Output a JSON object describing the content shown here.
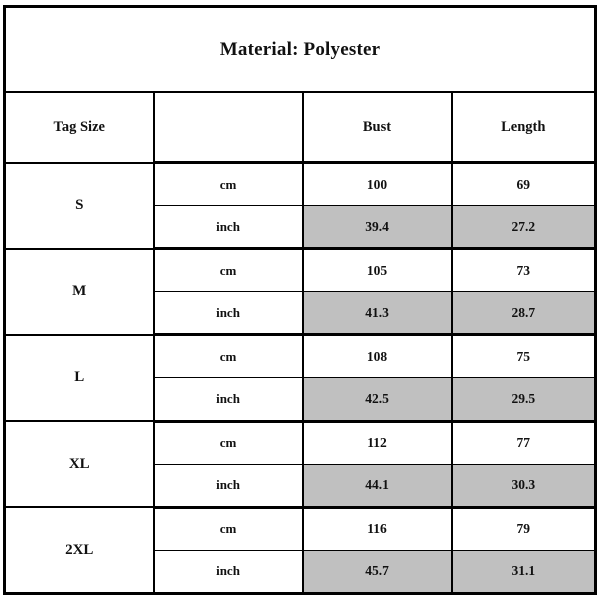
{
  "title": "Material: Polyester",
  "headers": {
    "size": "Tag Size",
    "unit": "",
    "bust": "Bust",
    "length": "Length"
  },
  "units": {
    "metric": "cm",
    "imperial": "inch"
  },
  "colors": {
    "shaded_row_background": "#c0c0c0",
    "border": "#000000",
    "page_background": "#ffffff"
  },
  "rows": [
    {
      "size": "S",
      "cm": {
        "unit": "cm",
        "bust": "100",
        "length": "69"
      },
      "inch": {
        "unit": "inch",
        "bust": "39.4",
        "length": "27.2"
      }
    },
    {
      "size": "M",
      "cm": {
        "unit": "cm",
        "bust": "105",
        "length": "73"
      },
      "inch": {
        "unit": "inch",
        "bust": "41.3",
        "length": "28.7"
      }
    },
    {
      "size": "L",
      "cm": {
        "unit": "cm",
        "bust": "108",
        "length": "75"
      },
      "inch": {
        "unit": "inch",
        "bust": "42.5",
        "length": "29.5"
      }
    },
    {
      "size": "XL",
      "cm": {
        "unit": "cm",
        "bust": "112",
        "length": "77"
      },
      "inch": {
        "unit": "inch",
        "bust": "44.1",
        "length": "30.3"
      }
    },
    {
      "size": "2XL",
      "cm": {
        "unit": "cm",
        "bust": "116",
        "length": "79"
      },
      "inch": {
        "unit": "inch",
        "bust": "45.7",
        "length": "31.1"
      }
    }
  ]
}
